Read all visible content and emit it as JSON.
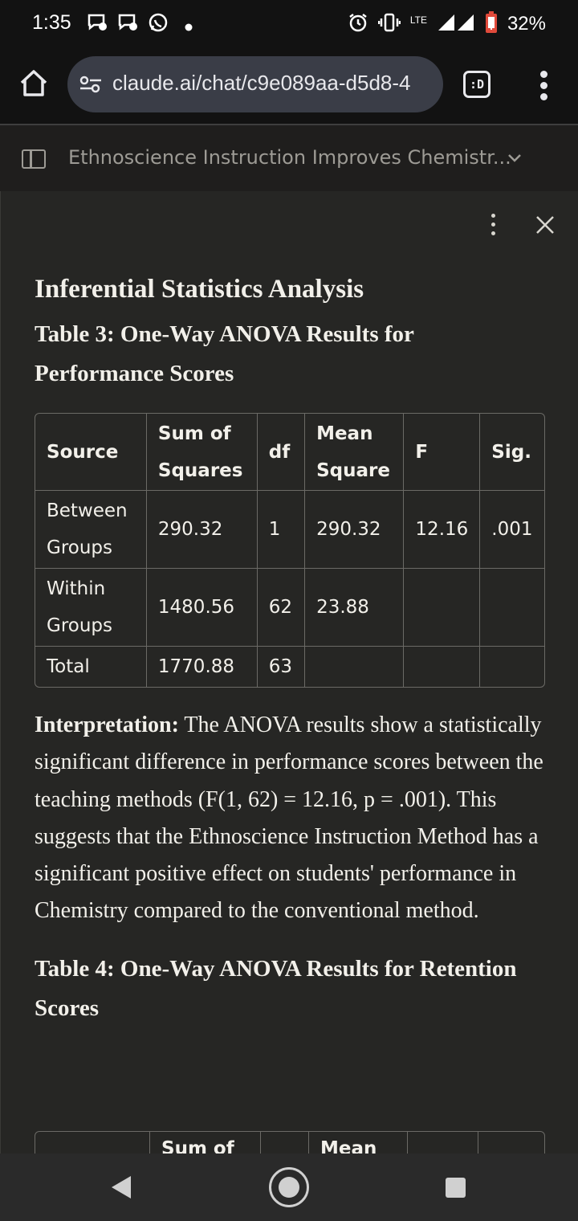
{
  "status_bar": {
    "time": "1:35",
    "network": "LTE",
    "battery": "32%"
  },
  "browser": {
    "url": "claude.ai/chat/c9e089aa-d5d8-4",
    "tab_icon_label": ":D"
  },
  "chat": {
    "title": "Ethnoscience Instruction Improves Chemistr..."
  },
  "doc": {
    "heading": "Inferential Statistics Analysis",
    "table3_title": "Table 3: One-Way ANOVA Results for Performance Scores",
    "table3": {
      "headers": [
        "Source",
        "Sum of Squares",
        "df",
        "Mean Square",
        "F",
        "Sig."
      ],
      "rows": [
        [
          "Between Groups",
          "290.32",
          "1",
          "290.32",
          "12.16",
          ".001"
        ],
        [
          "Within Groups",
          "1480.56",
          "62",
          "23.88",
          "",
          ""
        ],
        [
          "Total",
          "1770.88",
          "63",
          "",
          "",
          ""
        ]
      ]
    },
    "interpretation_label": "Interpretation:",
    "interpretation_text": " The ANOVA results show a statistically significant difference in performance scores between the teaching methods (F(1, 62) = 12.16, p = .001). This suggests that the Ethnoscience Instruction Method has a significant positive effect on students' performance in Chemistry compared to the conventional method.",
    "table4_title": "Table 4: One-Way ANOVA Results for Retention Scores",
    "table4_headers_visible": [
      "Sum of",
      "Mean"
    ]
  },
  "colors": {
    "panel_bg": "#262624",
    "header_bg": "#1f1e1d",
    "system_bar_bg": "#121212",
    "url_pill_bg": "#3a3d47",
    "text": "#f2f0ea",
    "muted_text": "#9d9b95",
    "border": "#6b6a66",
    "battery_red": "#e04a3b"
  }
}
